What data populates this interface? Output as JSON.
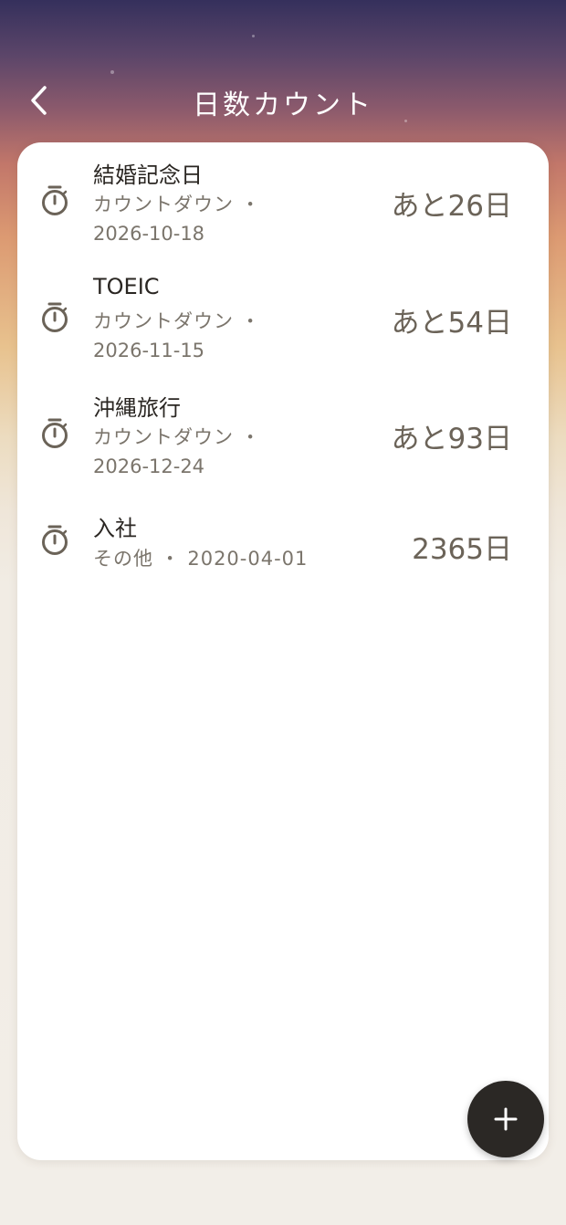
{
  "header": {
    "title": "日数カウント",
    "back_icon": "chevron-left-icon"
  },
  "items": [
    {
      "name": "結婚記念日",
      "type": "カウントダウン ・",
      "date": "2026-10-18",
      "days": "あと26日",
      "icon": "stopwatch-icon"
    },
    {
      "name": "TOEIC",
      "type": "カウントダウン ・",
      "date": "2026-11-15",
      "days": "あと54日",
      "icon": "stopwatch-icon"
    },
    {
      "name": "沖縄旅行",
      "type": "カウントダウン ・",
      "date": "2026-12-24",
      "days": "あと93日",
      "icon": "stopwatch-icon"
    },
    {
      "name": "入社",
      "meta": "その他 ・ 2020-04-01",
      "days": "2365日",
      "icon": "stopwatch-icon"
    }
  ],
  "fab": {
    "icon": "plus-icon"
  },
  "colors": {
    "accent_dark": "#2b2825",
    "value_text": "#6b6358",
    "secondary_text": "#7b756c"
  }
}
